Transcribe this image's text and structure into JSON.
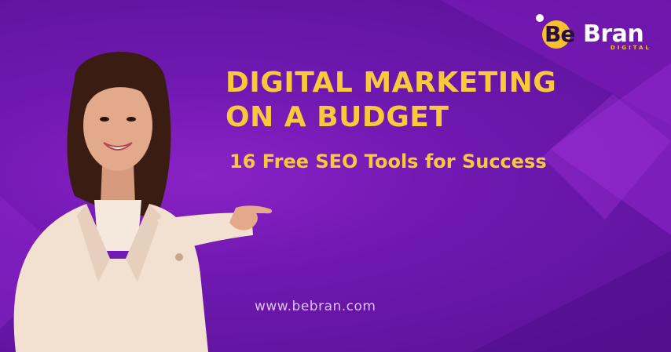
{
  "brand": {
    "logo_be": "Be",
    "logo_bran": "Bran",
    "logo_sub": "DIGITAL"
  },
  "headline": {
    "line1": "DIGITAL MARKETING",
    "line2": "ON A BUDGET"
  },
  "subheadline": "16 Free SEO Tools for Success",
  "website": "www.bebran.com",
  "colors": {
    "background": "#6f18b0",
    "headline": "#f8c93a",
    "logo_accent": "#f6c12b",
    "blazer": "#f2e0d0"
  },
  "illustration": "smiling-woman-pointing-icon"
}
